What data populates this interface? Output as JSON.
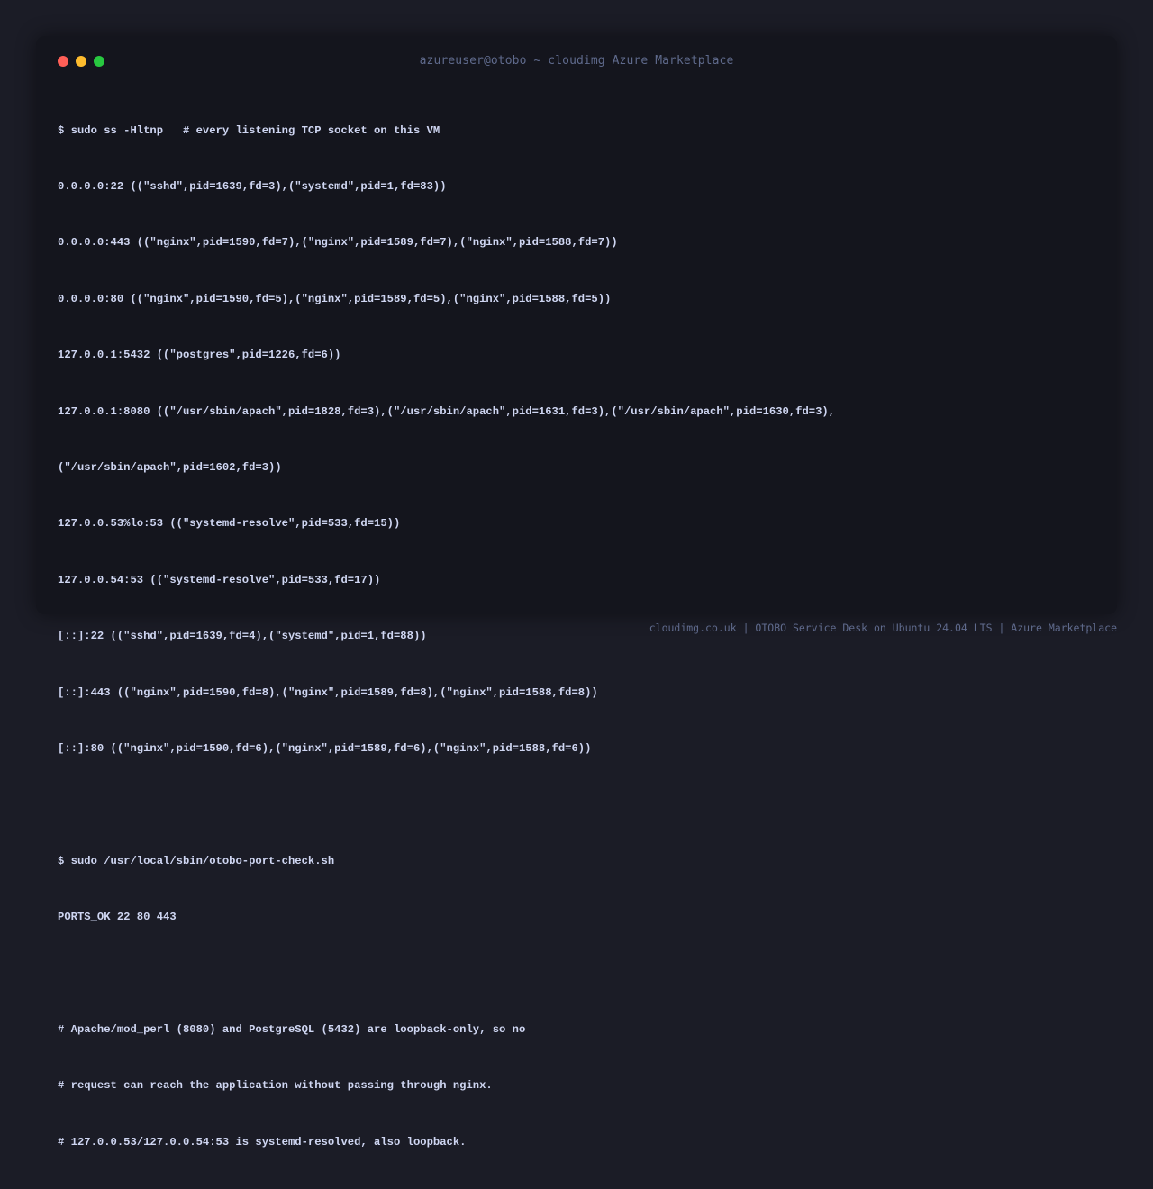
{
  "window": {
    "title": "azureuser@otobo ~ cloudimg Azure Marketplace",
    "controls": {
      "close_color": "#ff5f57",
      "minimize_color": "#febc2e",
      "maximize_color": "#28c840"
    }
  },
  "terminal": {
    "lines": [
      "$ sudo ss -Hltnp   # every listening TCP socket on this VM",
      "0.0.0.0:22 ((\"sshd\",pid=1639,fd=3),(\"systemd\",pid=1,fd=83))",
      "0.0.0.0:443 ((\"nginx\",pid=1590,fd=7),(\"nginx\",pid=1589,fd=7),(\"nginx\",pid=1588,fd=7))",
      "0.0.0.0:80 ((\"nginx\",pid=1590,fd=5),(\"nginx\",pid=1589,fd=5),(\"nginx\",pid=1588,fd=5))",
      "127.0.0.1:5432 ((\"postgres\",pid=1226,fd=6))",
      "127.0.0.1:8080 ((\"/usr/sbin/apach\",pid=1828,fd=3),(\"/usr/sbin/apach\",pid=1631,fd=3),(\"/usr/sbin/apach\",pid=1630,fd=3),",
      "(\"/usr/sbin/apach\",pid=1602,fd=3))",
      "127.0.0.53%lo:53 ((\"systemd-resolve\",pid=533,fd=15))",
      "127.0.0.54:53 ((\"systemd-resolve\",pid=533,fd=17))",
      "[::]:22 ((\"sshd\",pid=1639,fd=4),(\"systemd\",pid=1,fd=88))",
      "[::]:443 ((\"nginx\",pid=1590,fd=8),(\"nginx\",pid=1589,fd=8),(\"nginx\",pid=1588,fd=8))",
      "[::]:80 ((\"nginx\",pid=1590,fd=6),(\"nginx\",pid=1589,fd=6),(\"nginx\",pid=1588,fd=6))",
      "",
      "$ sudo /usr/local/sbin/otobo-port-check.sh",
      "PORTS_OK 22 80 443",
      "",
      "# Apache/mod_perl (8080) and PostgreSQL (5432) are loopback-only, so no",
      "# request can reach the application without passing through nginx.",
      "# 127.0.0.53/127.0.0.54:53 is systemd-resolved, also loopback."
    ]
  },
  "footer": {
    "text": "cloudimg.co.uk | OTOBO Service Desk on Ubuntu 24.04 LTS | Azure Marketplace"
  }
}
